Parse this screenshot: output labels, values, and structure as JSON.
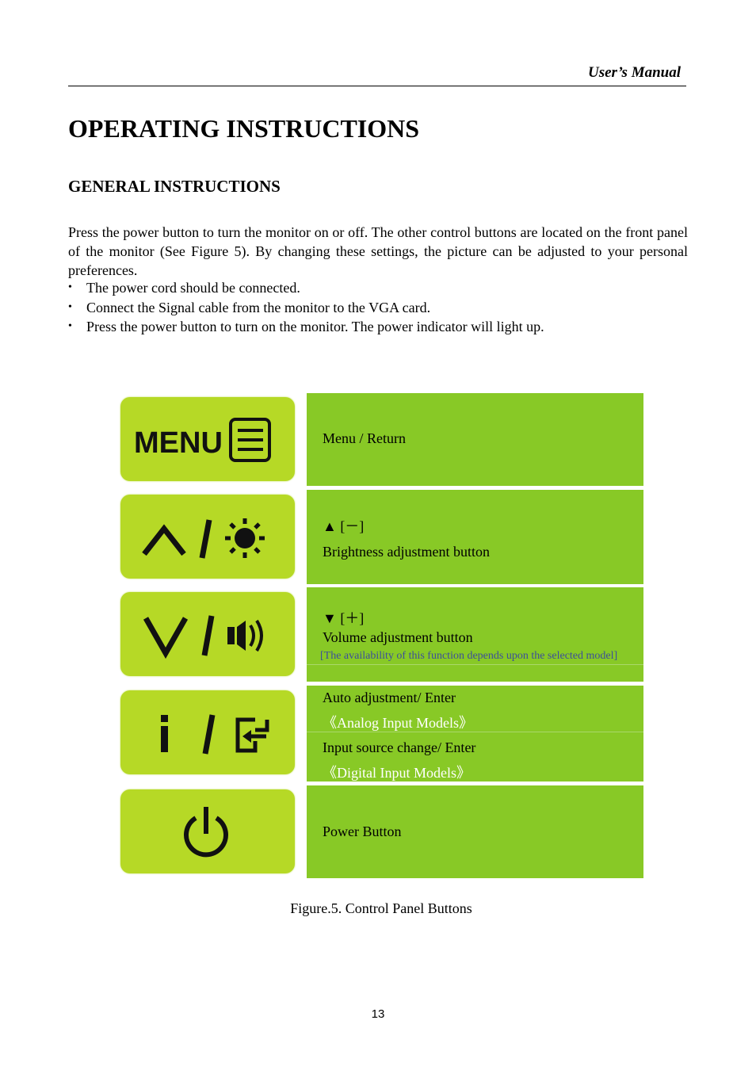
{
  "header": {
    "title": "User’s Manual"
  },
  "page_title": "OPERATING INSTRUCTIONS",
  "section_title": "GENERAL INSTRUCTIONS",
  "intro": "Press the power button to turn the monitor on or off. The other control buttons are located on the front panel of the monitor (See Figure 5). By changing these settings, the picture can be adjusted to your personal preferences.",
  "bullets": [
    "The power cord should be connected.",
    "Connect the Signal cable from the monitor to the VGA card.",
    "Press the power button to turn on the monitor. The power indicator will light up."
  ],
  "bullet_glyph": "•",
  "figure": {
    "colors": {
      "button_face": "#b6d926",
      "description_bg": "#88c926",
      "note_text": "#3c4f9a",
      "icon": "#111111"
    },
    "buttons": [
      {
        "icon": "menu-icon",
        "icon_text": "MENU",
        "lines": [
          "Menu / Return"
        ]
      },
      {
        "icon": "up-brightness-icon",
        "lines": [
          "▲ [－]",
          "Brightness adjustment button"
        ]
      },
      {
        "icon": "down-volume-icon",
        "lines": [
          "▼ [＋]",
          "Volume adjustment button"
        ],
        "note": "[The availability of this function depends upon the selected model]"
      },
      {
        "icon": "info-input-icon",
        "lines": [
          "Auto adjustment/ Enter",
          "《Analog Input Models》",
          "Input source change/ Enter",
          "《Digital Input Models》"
        ]
      },
      {
        "icon": "power-icon",
        "lines": [
          "Power Button"
        ]
      }
    ],
    "caption": "Figure.5. Control Panel Buttons"
  },
  "page_number": "13"
}
